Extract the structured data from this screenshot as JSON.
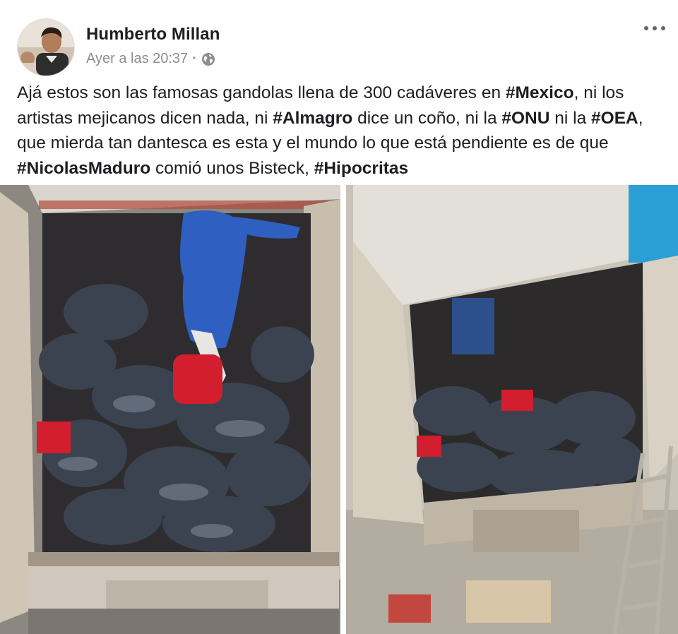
{
  "post": {
    "author": "Humberto Millan",
    "timestamp": "Ayer a las 20:37",
    "separator": "·",
    "privacy_icon": "globe-icon",
    "menu_icon": "more-options-icon",
    "text_segments": [
      {
        "t": "Ajá estos son las famosas gandolas llena de 300 cadáveres en "
      },
      {
        "tag": "#Mexico"
      },
      {
        "t": ", ni los artistas mejicanos dicen nada, ni "
      },
      {
        "tag": "#Almagro"
      },
      {
        "t": " dice un coño, ni la "
      },
      {
        "tag": "#ONU"
      },
      {
        "t": " ni la "
      },
      {
        "tag": "#OEA"
      },
      {
        "t": ", que mierda tan dantesca es esta y el mundo lo que está pendiente es de que "
      },
      {
        "tag": "#NicolasMaduro"
      },
      {
        "t": " comió unos Bisteck, "
      },
      {
        "tag": "#Hipocritas"
      }
    ],
    "photos": [
      {
        "name": "photo-truck-top-view",
        "kind": "image"
      },
      {
        "name": "photo-truck-side-view",
        "kind": "image"
      }
    ],
    "colors": {
      "text": "#1c1e21",
      "meta": "#8a8d91",
      "background": "#ffffff"
    }
  }
}
